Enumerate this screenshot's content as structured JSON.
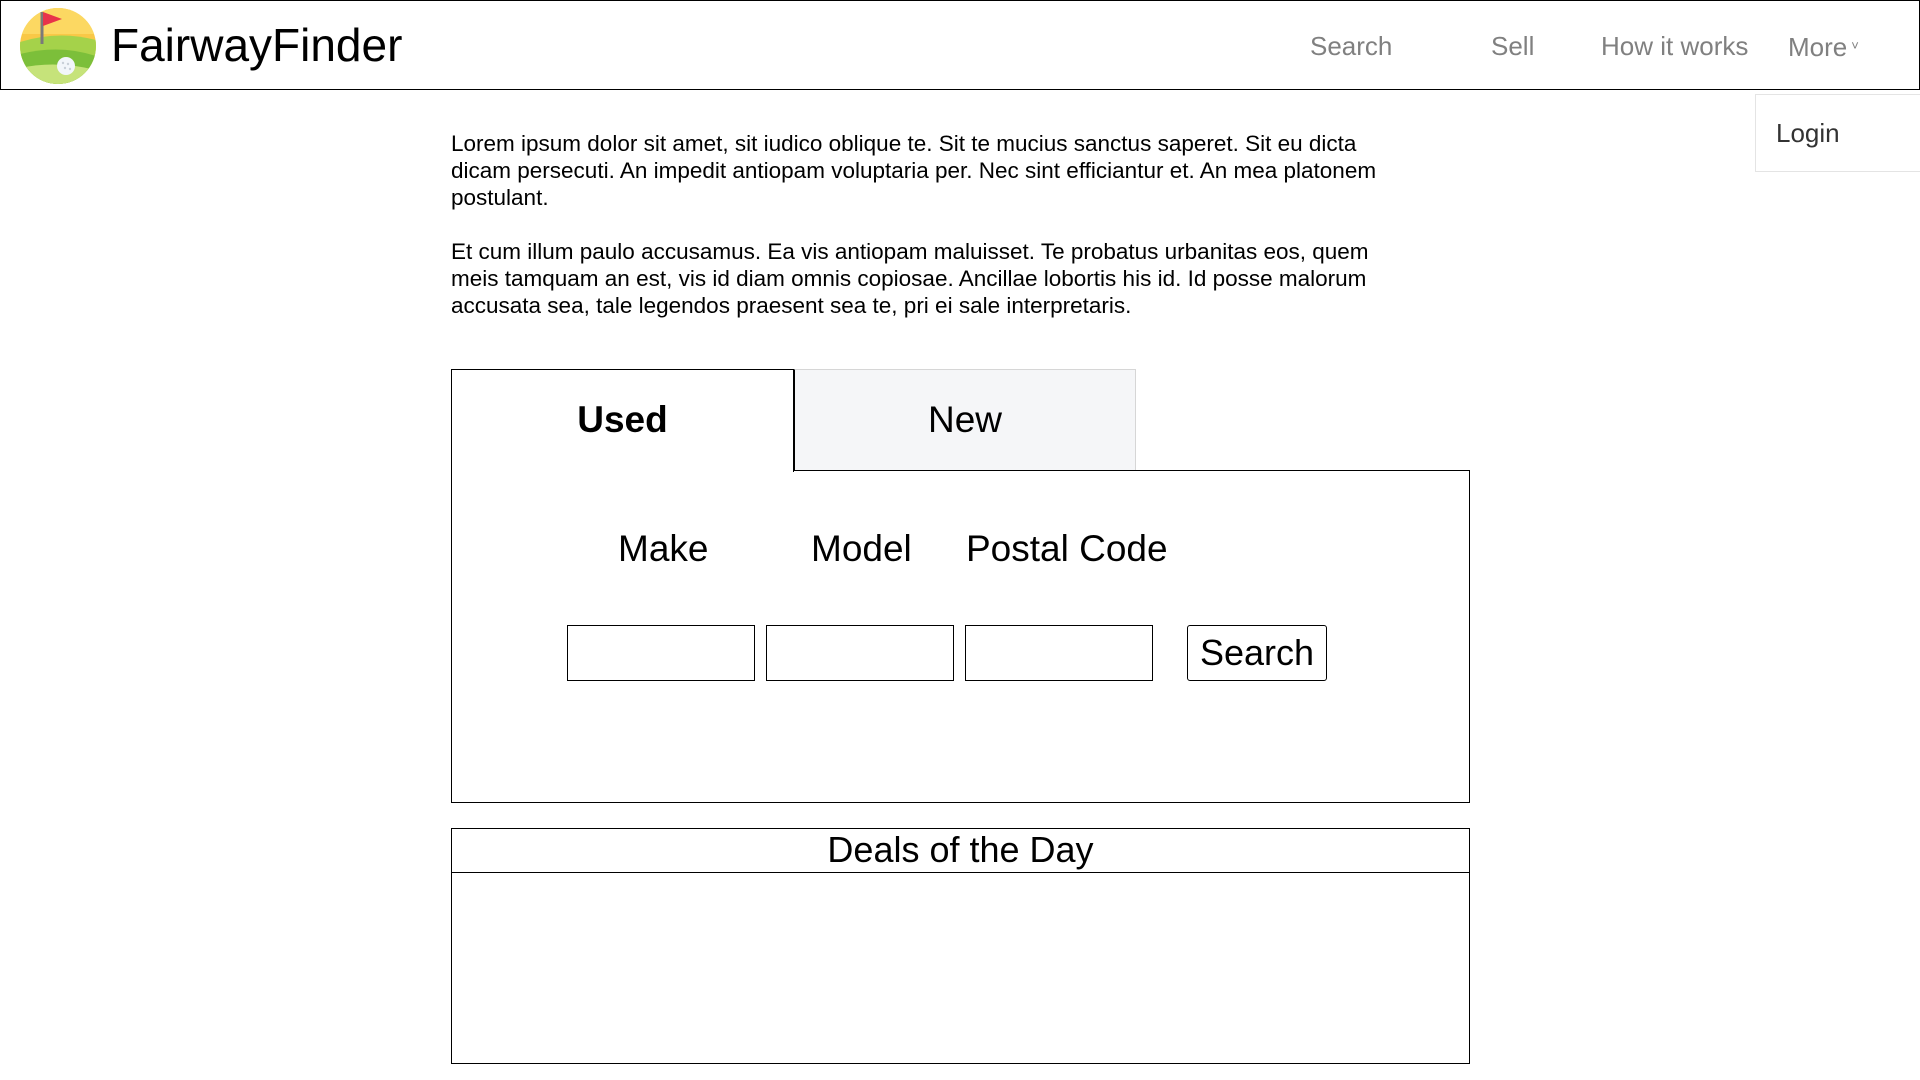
{
  "brand": {
    "name": "FairwayFinder",
    "logo_icon": "golf-course-flag-icon"
  },
  "nav": {
    "items": [
      {
        "label": "Search"
      },
      {
        "label": "Sell"
      },
      {
        "label": "How it works"
      },
      {
        "label": "More"
      }
    ],
    "more_chevron": "˅"
  },
  "dropdown": {
    "items": [
      {
        "label": "Login"
      }
    ]
  },
  "intro": {
    "paragraphs": [
      "Lorem ipsum dolor sit amet, sit iudico oblique te. Sit te mucius sanctus saperet. Sit eu dicta dicam persecuti. An impedit antiopam voluptaria per. Nec sint efficiantur et. An mea platonem postulant.",
      "Et cum illum paulo accusamus. Ea vis antiopam maluisset. Te probatus urbanitas eos, quem meis tamquam an est, vis id diam omnis copiosae. Ancillae lobortis his id. Id posse malorum accusata sea, tale legendos praesent sea te, pri ei sale interpretaris."
    ]
  },
  "tabs": [
    {
      "label": "Used",
      "active": true
    },
    {
      "label": "New",
      "active": false
    }
  ],
  "search_form": {
    "fields": [
      {
        "label": "Make",
        "value": "",
        "placeholder": ""
      },
      {
        "label": "Model",
        "value": "",
        "placeholder": ""
      },
      {
        "label": "Postal Code",
        "value": "",
        "placeholder": ""
      }
    ],
    "submit_label": "Search"
  },
  "deals": {
    "title": "Deals of the Day"
  },
  "colors": {
    "nav_text": "#808080",
    "inactive_tab_bg": "#f5f6f8",
    "logo_yellow": "#f9c847",
    "logo_green": "#8cc63f",
    "flag_red": "#e8334a"
  }
}
